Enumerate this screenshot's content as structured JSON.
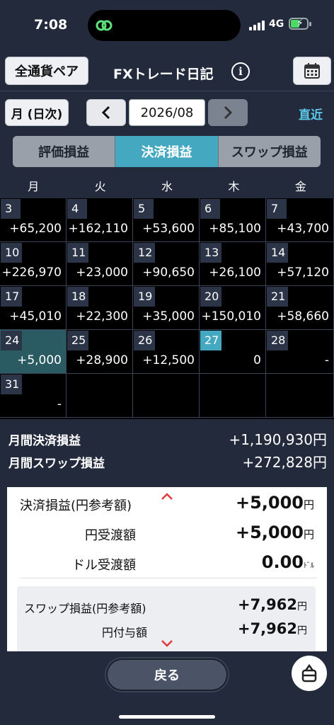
{
  "status": {
    "time": "7:08",
    "network": "4G"
  },
  "header": {
    "pair_label": "全通貨ペア",
    "title": "FXトレード日記",
    "info_symbol": "i"
  },
  "nav": {
    "mode_label": "月 (日次)",
    "month": "2026/08",
    "latest_label": "直近"
  },
  "tabs": [
    {
      "label": "評価損益",
      "active": false
    },
    {
      "label": "決済損益",
      "active": true
    },
    {
      "label": "スワップ損益",
      "active": false
    }
  ],
  "weekdays": [
    "月",
    "火",
    "水",
    "木",
    "金"
  ],
  "calendar": [
    [
      {
        "day": "3",
        "value": "+65,200"
      },
      {
        "day": "4",
        "value": "+162,110"
      },
      {
        "day": "5",
        "value": "+53,600"
      },
      {
        "day": "6",
        "value": "+85,100"
      },
      {
        "day": "7",
        "value": "+43,700"
      }
    ],
    [
      {
        "day": "10",
        "value": "+226,970"
      },
      {
        "day": "11",
        "value": "+23,000"
      },
      {
        "day": "12",
        "value": "+90,650"
      },
      {
        "day": "13",
        "value": "+26,100"
      },
      {
        "day": "14",
        "value": "+57,120"
      }
    ],
    [
      {
        "day": "17",
        "value": "+45,010"
      },
      {
        "day": "18",
        "value": "+22,300"
      },
      {
        "day": "19",
        "value": "+35,000"
      },
      {
        "day": "20",
        "value": "+150,010"
      },
      {
        "day": "21",
        "value": "+58,660"
      }
    ],
    [
      {
        "day": "24",
        "value": "+5,000",
        "selected": true
      },
      {
        "day": "25",
        "value": "+28,900"
      },
      {
        "day": "26",
        "value": "+12,500"
      },
      {
        "day": "27",
        "value": "0",
        "today": true
      },
      {
        "day": "28",
        "value": "-"
      }
    ],
    [
      {
        "day": "31",
        "value": "-"
      },
      {
        "day": "",
        "value": ""
      },
      {
        "day": "",
        "value": ""
      },
      {
        "day": "",
        "value": ""
      },
      {
        "day": "",
        "value": ""
      }
    ]
  ],
  "totals": {
    "settled_label": "月間決済損益",
    "settled_value": "+1,190,930円",
    "swap_label": "月間スワップ損益",
    "swap_value": "+272,828円"
  },
  "detail": {
    "settled_label": "決済損益(円参考額)",
    "settled_value": "+5,000",
    "settled_unit": "円",
    "yen_label": "円受渡額",
    "yen_value": "+5,000",
    "yen_unit": "円",
    "usd_label": "ドル受渡額",
    "usd_value": "0.00",
    "usd_unit": "ﾄﾞﾙ",
    "swap_label": "スワップ損益(円参考額)",
    "swap_value": "+7,962",
    "swap_unit": "円",
    "swap_yen_label": "円付与額",
    "swap_yen_value": "+7,962",
    "swap_yen_unit": "円"
  },
  "footer": {
    "back_label": "戻る"
  },
  "colors": {
    "accent": "#44a9c0",
    "chevron": "#e03a3a",
    "background": "#222a3c"
  }
}
